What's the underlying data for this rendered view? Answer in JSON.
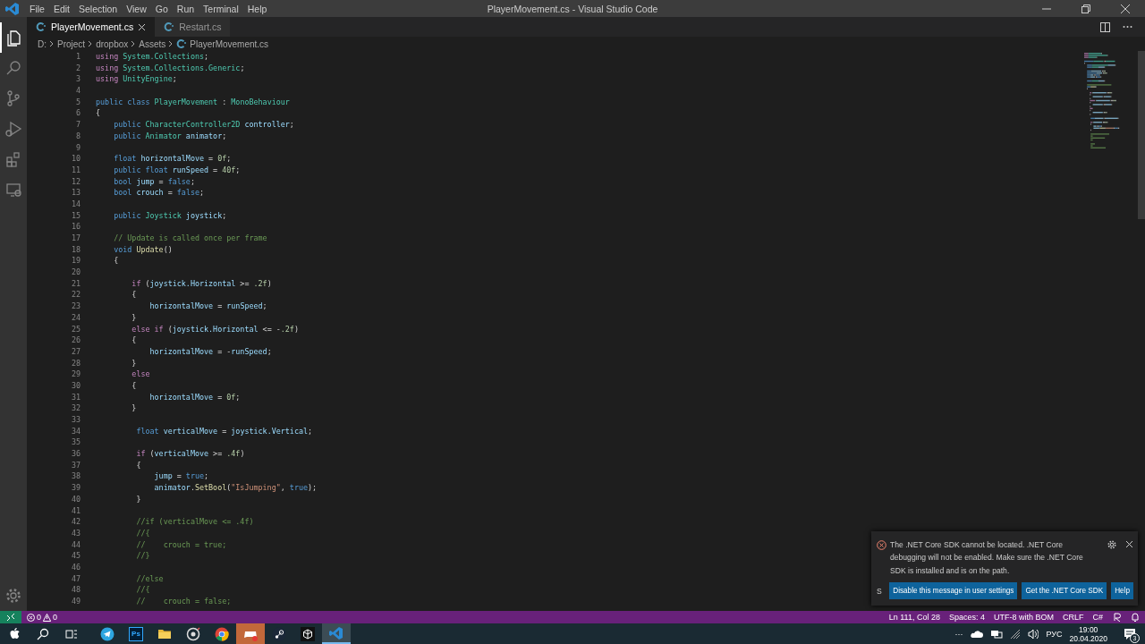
{
  "window": {
    "title": "PlayerMovement.cs - Visual Studio Code"
  },
  "menu": [
    "File",
    "Edit",
    "Selection",
    "View",
    "Go",
    "Run",
    "Terminal",
    "Help"
  ],
  "activity_bar": [
    {
      "kind": "files",
      "selected": true
    },
    {
      "kind": "search",
      "selected": false
    },
    {
      "kind": "scm",
      "selected": false
    },
    {
      "kind": "run",
      "selected": false
    },
    {
      "kind": "extensions",
      "selected": false
    },
    {
      "kind": "remote",
      "selected": false
    }
  ],
  "tabs": [
    {
      "label": "PlayerMovement.cs",
      "selected": true
    },
    {
      "label": "Restart.cs",
      "selected": false
    }
  ],
  "breadcrumb": [
    "D:",
    "Project",
    "dropbox",
    "Assets",
    "PlayerMovement.cs"
  ],
  "code": [
    {
      "number": "1",
      "tokens": [
        {
          "kind": "control",
          "text": "using "
        },
        {
          "kind": "type",
          "text": "System.Collections"
        },
        {
          "kind": "plain",
          "text": ";"
        }
      ]
    },
    {
      "number": "2",
      "tokens": [
        {
          "kind": "control",
          "text": "using "
        },
        {
          "kind": "type",
          "text": "System.Collections.Generic"
        },
        {
          "kind": "plain",
          "text": ";"
        }
      ]
    },
    {
      "number": "3",
      "tokens": [
        {
          "kind": "control",
          "text": "using "
        },
        {
          "kind": "type",
          "text": "UnityEngine"
        },
        {
          "kind": "plain",
          "text": ";"
        }
      ]
    },
    {
      "number": "4"
    },
    {
      "number": "5",
      "tokens": [
        {
          "kind": "keyword",
          "text": "public class "
        },
        {
          "kind": "type",
          "text": "PlayerMovement"
        },
        {
          "kind": "plain",
          "text": " : "
        },
        {
          "kind": "type",
          "text": "MonoBehaviour"
        }
      ]
    },
    {
      "number": "6",
      "tokens": [
        {
          "kind": "plain",
          "text": "{"
        }
      ]
    },
    {
      "number": "7",
      "tokens": [
        {
          "kind": "keyword",
          "text": "    public "
        },
        {
          "kind": "type",
          "text": "CharacterController2D "
        },
        {
          "kind": "variable",
          "text": "controller"
        },
        {
          "kind": "plain",
          "text": ";"
        }
      ]
    },
    {
      "number": "8",
      "tokens": [
        {
          "kind": "keyword",
          "text": "    public "
        },
        {
          "kind": "type",
          "text": "Animator "
        },
        {
          "kind": "variable",
          "text": "animator"
        },
        {
          "kind": "plain",
          "text": ";"
        }
      ]
    },
    {
      "number": "9"
    },
    {
      "number": "10",
      "tokens": [
        {
          "kind": "keyword",
          "text": "    float "
        },
        {
          "kind": "variable",
          "text": "horizontalMove"
        },
        {
          "kind": "plain",
          "text": " = "
        },
        {
          "kind": "number",
          "text": "0f"
        },
        {
          "kind": "plain",
          "text": ";"
        }
      ]
    },
    {
      "number": "11",
      "tokens": [
        {
          "kind": "keyword",
          "text": "    public float "
        },
        {
          "kind": "variable",
          "text": "runSpeed"
        },
        {
          "kind": "plain",
          "text": " = "
        },
        {
          "kind": "number",
          "text": "40f"
        },
        {
          "kind": "plain",
          "text": ";"
        }
      ]
    },
    {
      "number": "12",
      "tokens": [
        {
          "kind": "keyword",
          "text": "    bool "
        },
        {
          "kind": "variable",
          "text": "jump"
        },
        {
          "kind": "plain",
          "text": " = "
        },
        {
          "kind": "keyword",
          "text": "false"
        },
        {
          "kind": "plain",
          "text": ";"
        }
      ]
    },
    {
      "number": "13",
      "tokens": [
        {
          "kind": "keyword",
          "text": "    bool "
        },
        {
          "kind": "variable",
          "text": "crouch"
        },
        {
          "kind": "plain",
          "text": " = "
        },
        {
          "kind": "keyword",
          "text": "false"
        },
        {
          "kind": "plain",
          "text": ";"
        }
      ]
    },
    {
      "number": "14"
    },
    {
      "number": "15",
      "tokens": [
        {
          "kind": "keyword",
          "text": "    public "
        },
        {
          "kind": "type",
          "text": "Joystick "
        },
        {
          "kind": "variable",
          "text": "joystick"
        },
        {
          "kind": "plain",
          "text": ";"
        }
      ]
    },
    {
      "number": "16"
    },
    {
      "number": "17",
      "tokens": [
        {
          "kind": "comment",
          "text": "    // Update is called once per frame"
        }
      ]
    },
    {
      "number": "18",
      "tokens": [
        {
          "kind": "keyword",
          "text": "    void "
        },
        {
          "kind": "function",
          "text": "Update"
        },
        {
          "kind": "plain",
          "text": "()"
        }
      ]
    },
    {
      "number": "19",
      "tokens": [
        {
          "kind": "plain",
          "text": "    {"
        }
      ]
    },
    {
      "number": "20"
    },
    {
      "number": "21",
      "tokens": [
        {
          "kind": "control",
          "text": "        if"
        },
        {
          "kind": "plain",
          "text": " ("
        },
        {
          "kind": "variable",
          "text": "joystick.Horizontal"
        },
        {
          "kind": "plain",
          "text": " >= "
        },
        {
          "kind": "number",
          "text": ".2f"
        },
        {
          "kind": "plain",
          "text": ")"
        }
      ]
    },
    {
      "number": "22",
      "tokens": [
        {
          "kind": "plain",
          "text": "        {"
        }
      ]
    },
    {
      "number": "23",
      "tokens": [
        {
          "kind": "variable",
          "text": "            horizontalMove"
        },
        {
          "kind": "plain",
          "text": " = "
        },
        {
          "kind": "variable",
          "text": "runSpeed"
        },
        {
          "kind": "plain",
          "text": ";"
        }
      ]
    },
    {
      "number": "24",
      "tokens": [
        {
          "kind": "plain",
          "text": "        }"
        }
      ]
    },
    {
      "number": "25",
      "tokens": [
        {
          "kind": "control",
          "text": "        else if"
        },
        {
          "kind": "plain",
          "text": " ("
        },
        {
          "kind": "variable",
          "text": "joystick.Horizontal"
        },
        {
          "kind": "plain",
          "text": " <= -"
        },
        {
          "kind": "number",
          "text": ".2f"
        },
        {
          "kind": "plain",
          "text": ")"
        }
      ]
    },
    {
      "number": "26",
      "tokens": [
        {
          "kind": "plain",
          "text": "        {"
        }
      ]
    },
    {
      "number": "27",
      "tokens": [
        {
          "kind": "variable",
          "text": "            horizontalMove"
        },
        {
          "kind": "plain",
          "text": " = -"
        },
        {
          "kind": "variable",
          "text": "runSpeed"
        },
        {
          "kind": "plain",
          "text": ";"
        }
      ]
    },
    {
      "number": "28",
      "tokens": [
        {
          "kind": "plain",
          "text": "        }"
        }
      ]
    },
    {
      "number": "29",
      "tokens": [
        {
          "kind": "control",
          "text": "        else"
        }
      ]
    },
    {
      "number": "30",
      "tokens": [
        {
          "kind": "plain",
          "text": "        {"
        }
      ]
    },
    {
      "number": "31",
      "tokens": [
        {
          "kind": "variable",
          "text": "            horizontalMove"
        },
        {
          "kind": "plain",
          "text": " = "
        },
        {
          "kind": "number",
          "text": "0f"
        },
        {
          "kind": "plain",
          "text": ";"
        }
      ]
    },
    {
      "number": "32",
      "tokens": [
        {
          "kind": "plain",
          "text": "        }"
        }
      ]
    },
    {
      "number": "33"
    },
    {
      "number": "34",
      "tokens": [
        {
          "kind": "keyword",
          "text": "         float "
        },
        {
          "kind": "variable",
          "text": "verticalMove"
        },
        {
          "kind": "plain",
          "text": " = "
        },
        {
          "kind": "variable",
          "text": "joystick.Vertical"
        },
        {
          "kind": "plain",
          "text": ";"
        }
      ]
    },
    {
      "number": "35"
    },
    {
      "number": "36",
      "tokens": [
        {
          "kind": "control",
          "text": "         if"
        },
        {
          "kind": "plain",
          "text": " ("
        },
        {
          "kind": "variable",
          "text": "verticalMove"
        },
        {
          "kind": "plain",
          "text": " >= "
        },
        {
          "kind": "number",
          "text": ".4f"
        },
        {
          "kind": "plain",
          "text": ")"
        }
      ]
    },
    {
      "number": "37",
      "tokens": [
        {
          "kind": "plain",
          "text": "         {"
        }
      ]
    },
    {
      "number": "38",
      "tokens": [
        {
          "kind": "variable",
          "text": "             jump"
        },
        {
          "kind": "plain",
          "text": " = "
        },
        {
          "kind": "keyword",
          "text": "true"
        },
        {
          "kind": "plain",
          "text": ";"
        }
      ]
    },
    {
      "number": "39",
      "tokens": [
        {
          "kind": "variable",
          "text": "             animator"
        },
        {
          "kind": "plain",
          "text": "."
        },
        {
          "kind": "function",
          "text": "SetBool"
        },
        {
          "kind": "plain",
          "text": "("
        },
        {
          "kind": "string",
          "text": "\"IsJumping\""
        },
        {
          "kind": "plain",
          "text": ", "
        },
        {
          "kind": "keyword",
          "text": "true"
        },
        {
          "kind": "plain",
          "text": ");"
        }
      ]
    },
    {
      "number": "40",
      "tokens": [
        {
          "kind": "plain",
          "text": "         }"
        }
      ]
    },
    {
      "number": "41"
    },
    {
      "number": "42",
      "tokens": [
        {
          "kind": "comment",
          "text": "         //if (verticalMove <= .4f)"
        }
      ]
    },
    {
      "number": "43",
      "tokens": [
        {
          "kind": "comment",
          "text": "         //{"
        }
      ]
    },
    {
      "number": "44",
      "tokens": [
        {
          "kind": "comment",
          "text": "         //    crouch = true;"
        }
      ]
    },
    {
      "number": "45",
      "tokens": [
        {
          "kind": "comment",
          "text": "         //}"
        }
      ]
    },
    {
      "number": "46"
    },
    {
      "number": "47",
      "tokens": [
        {
          "kind": "comment",
          "text": "         //else"
        }
      ]
    },
    {
      "number": "48",
      "tokens": [
        {
          "kind": "comment",
          "text": "         //{"
        }
      ]
    },
    {
      "number": "49",
      "tokens": [
        {
          "kind": "comment",
          "text": "         //    crouch = false;"
        }
      ]
    }
  ],
  "notification": {
    "message": "The .NET Core SDK cannot be located. .NET Core debugging will not be enabled. Make sure the .NET Core SDK is installed and is on the path.",
    "source": "S",
    "buttons": [
      "Disable this message in user settings",
      "Get the .NET Core SDK",
      "Help"
    ]
  },
  "status_bar": {
    "errors": "0",
    "warnings": "0",
    "items": [
      "Ln 111, Col 28",
      "Spaces: 4",
      "UTF-8 with BOM",
      "CRLF",
      "C#"
    ]
  },
  "taskbar": {
    "apps": [
      {
        "kind": "start",
        "selected": false,
        "flashing": false
      },
      {
        "kind": "search",
        "selected": false,
        "flashing": false
      },
      {
        "kind": "taskview",
        "selected": false,
        "flashing": false
      },
      {
        "kind": "plane",
        "selected": false,
        "flashing": false
      },
      {
        "kind": "ps",
        "label": "Ps",
        "selected": false,
        "flashing": false
      },
      {
        "kind": "folder",
        "selected": false,
        "flashing": false
      },
      {
        "kind": "disc",
        "selected": false,
        "flashing": false
      },
      {
        "kind": "chrome",
        "selected": false,
        "flashing": false
      },
      {
        "kind": "gamepad",
        "selected": false,
        "flashing": true
      },
      {
        "kind": "steam",
        "selected": false,
        "flashing": false
      },
      {
        "kind": "cube",
        "selected": false,
        "flashing": false
      },
      {
        "kind": "ribbon",
        "selected": true,
        "flashing": false
      }
    ],
    "tray": {
      "overflow": "···",
      "language": "РУС",
      "time": "19:00",
      "date": "20.04.2020",
      "notifications": "3"
    }
  }
}
